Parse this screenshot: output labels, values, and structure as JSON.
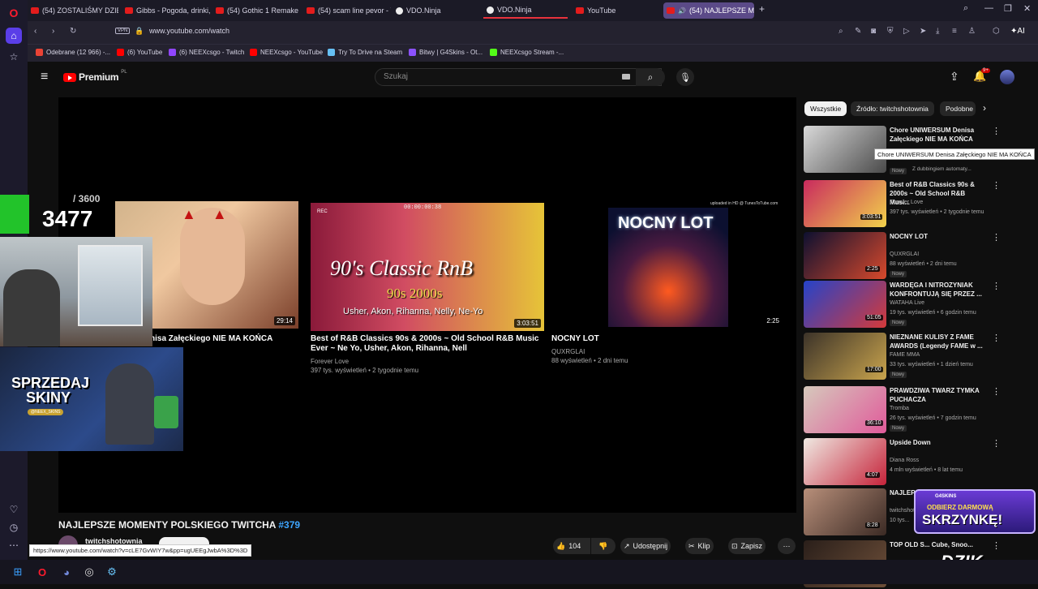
{
  "tabs": [
    {
      "label": "(54) ZOSTALIŚMY DZIENN"
    },
    {
      "label": "Gibbs - Pogoda, drinki, pi"
    },
    {
      "label": "(54) Gothic 1 Remake - M"
    },
    {
      "label": "(54) scam line pevor - You"
    },
    {
      "label": "VDO.Ninja"
    },
    {
      "label": "VDO.Ninja"
    },
    {
      "label": "YouTube"
    },
    {
      "label": "(54) NAJLEPSZE MOM"
    }
  ],
  "tab_add": "+",
  "address": {
    "vpn": "VPN",
    "url": "www.youtube.com/watch",
    "ai": "AI"
  },
  "bookmarks": [
    {
      "label": "Odebrane (12 966) -...",
      "color": "#ea4335"
    },
    {
      "label": "(6) YouTube",
      "color": "#ff0000"
    },
    {
      "label": "(6) NEEXcsgo - Twitch",
      "color": "#9146ff"
    },
    {
      "label": "NEEXcsgo - YouTube",
      "color": "#ff0000"
    },
    {
      "label": "Try To Drive na Steam",
      "color": "#66c0f4"
    },
    {
      "label": "Bitwy | G4Skins - Ot...",
      "color": "#8c52ff"
    },
    {
      "label": "NEEXcsgo Stream -...",
      "color": "#53fc18"
    }
  ],
  "youtube": {
    "logo": "Premium",
    "region": "PL",
    "search_placeholder": "Szukaj",
    "notif_count": "9+"
  },
  "overlay": {
    "counter": "3477",
    "counter_total": "/ 3600",
    "promo_line1": "SPRZEDAJ",
    "promo_line2": "SKINY",
    "promo_sub": "@NEEX_SKINS"
  },
  "endcards": [
    {
      "title": "Chore UNIWERSUM Denisa Załęckiego NIE MA KOŃCA",
      "visible_title": "nisa Załęckiego NIE MA KOŃCA",
      "duration": "29:14"
    },
    {
      "title": "Best of R&B Classics 90s & 2000s ~ Old School R&B Music Ever ~ Ne Yo, Usher, Akon, Rihanna, Nell",
      "channel": "Forever Love",
      "meta": "397 tys. wyświetleń • 2 tygodnie temu",
      "duration": "3:03:51",
      "thumb_big": "90's Classic RnB",
      "thumb_years": "90s 2000s",
      "thumb_artists": "Usher, Akon, Rihanna, Nelly, Ne-Yo",
      "thumb_timer": "00:00:00:38",
      "thumb_rec": "REC"
    },
    {
      "title": "NOCNY LOT",
      "channel": "QUXRGLAI",
      "meta": "88 wyświetleń • 2 dni temu",
      "duration": "2:25",
      "thumb_text": "NOCNY LOT",
      "watermark": "uploaded in HD @ TunesToTube.com"
    }
  ],
  "chips": [
    {
      "label": "Wszystkie"
    },
    {
      "label": "Źródło: twitchshotownia"
    },
    {
      "label": "Podobne"
    }
  ],
  "recommendations": [
    {
      "title": "Chore UNIWERSUM Denisa Załęckiego NIE MA KOŃCA",
      "channel": "",
      "views": "",
      "badge": "Nowy",
      "extra": "Z dubbingiem automaty...",
      "duration": "",
      "color1": "#d9d9d9",
      "color2": "#4a4a4a"
    },
    {
      "title": "Best of R&B Classics 90s & 2000s ~ Old School R&B Musi...",
      "channel": "Forever Love",
      "views": "397 tys. wyświetleń • 2 tygodnie temu",
      "badge": "",
      "duration": "3:03:51",
      "color1": "#c92a5e",
      "color2": "#f2d24b"
    },
    {
      "title": "NOCNY LOT",
      "channel": "QUXRGLAI",
      "views": "88 wyświetleń • 2 dni temu",
      "badge": "Nowy",
      "duration": "2:25",
      "color1": "#0d1030",
      "color2": "#d8492c"
    },
    {
      "title": "WARDĘGA I NITROZYNIAK KONFRONTUJĄ SIĘ PRZEZ ...",
      "channel": "WATAHA Live",
      "views": "19 tys. wyświetleń • 6 godzin temu",
      "badge": "Nowy",
      "duration": "51:05",
      "color1": "#2543c9",
      "color2": "#d43a3a"
    },
    {
      "title": "NIEZNANE KULISY Z FAME AWARDS (Legendy FAME w ...",
      "channel": "FAME MMA",
      "views": "33 tys. wyświetleń • 1 dzień temu",
      "badge": "Nowy",
      "duration": "17:00",
      "color1": "#3c3329",
      "color2": "#c9a44d"
    },
    {
      "title": "PRAWDZIWA TWARZ TYMKA PUCHACZA",
      "channel": "Tromba",
      "views": "26 tys. wyświetleń • 7 godzin temu",
      "badge": "Nowy",
      "duration": "36:10",
      "color1": "#d6c9bc",
      "color2": "#e05a9a"
    },
    {
      "title": "Upside Down",
      "channel": "Diana Ross",
      "views": "4 mln wyświetleń • 8 lat temu",
      "badge": "",
      "duration": "4:07",
      "color1": "#efe9e2",
      "color2": "#c6233a"
    },
    {
      "title": "NAJLEPSZE POLSKIE...",
      "channel": "twitchshotownia",
      "views": "10 tys...",
      "badge": "",
      "duration": "8:28",
      "color1": "#b88f7a",
      "color2": "#3b2a24"
    },
    {
      "title": "TOP OLD S... Cube, Snoo...",
      "channel": "",
      "views": "",
      "badge": "",
      "duration": "",
      "color1": "#2a1f1a",
      "color2": "#6e4f39"
    }
  ],
  "tooltip": "Chore UNIWERSUM Denisa Załęckiego NIE MA KOŃCA",
  "video": {
    "title": "NAJLEPSZE MOMENTY POLSKIEGO TWITCHA",
    "hashtag": "#379",
    "channel": "twitchshotownia",
    "likes": "104",
    "share": "Udostępnij",
    "clip": "Klip",
    "save": "Zapisz"
  },
  "status_url": "https://www.youtube.com/watch?v=cLE7GvWIY7w&pp=ugUEEgJwbA%3D%3D",
  "ad": {
    "line1": "ODBIERZ DARMOWĄ",
    "line2": "SKRZYNKĘ!",
    "brand": "G4SKINS"
  },
  "brand_watermark": "DZIK"
}
